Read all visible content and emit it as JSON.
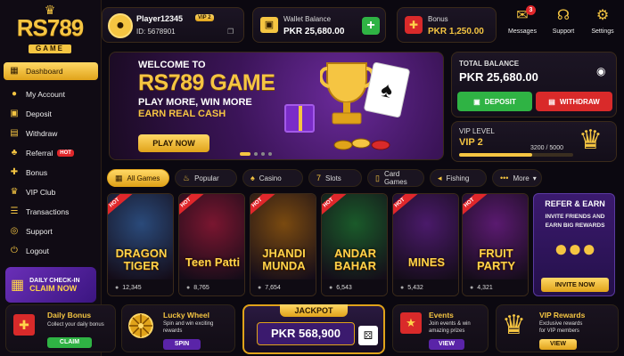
{
  "brand": {
    "name": "RS789",
    "sub": "GAME"
  },
  "sidebar": {
    "items": [
      {
        "label": "Dashboard",
        "icon": "dashboard-icon",
        "glyph": "▦"
      },
      {
        "label": "My Account",
        "icon": "user-icon",
        "glyph": "●"
      },
      {
        "label": "Deposit",
        "icon": "deposit-icon",
        "glyph": "▣"
      },
      {
        "label": "Withdraw",
        "icon": "withdraw-icon",
        "glyph": "▤"
      },
      {
        "label": "Referral",
        "icon": "referral-icon",
        "glyph": "♣"
      },
      {
        "label": "Bonus",
        "icon": "gift-icon",
        "glyph": "✚"
      },
      {
        "label": "VIP Club",
        "icon": "crown-icon",
        "glyph": "♛"
      },
      {
        "label": "Transactions",
        "icon": "list-icon",
        "glyph": "☰"
      },
      {
        "label": "Support",
        "icon": "headset-icon",
        "glyph": "◎"
      },
      {
        "label": "Logout",
        "icon": "logout-icon",
        "glyph": "⏻"
      }
    ],
    "hot_badge": "HOT",
    "checkin": {
      "line1": "DAILY CHECK-IN",
      "line2": "CLAIM NOW"
    }
  },
  "user": {
    "name": "Player12345",
    "vip_badge": "VIP 2",
    "id_label": "ID: 5678901"
  },
  "wallet": {
    "label": "Wallet Balance",
    "value": "PKR 25,680.00",
    "add": "+"
  },
  "bonus": {
    "label": "Bonus",
    "value": "PKR 1,250.00"
  },
  "header_actions": [
    {
      "label": "Messages",
      "icon": "mail-icon",
      "glyph": "✉",
      "badge": "3"
    },
    {
      "label": "Support",
      "icon": "headset-icon",
      "glyph": "☊",
      "badge": ""
    },
    {
      "label": "Settings",
      "icon": "gear-icon",
      "glyph": "⚙",
      "badge": ""
    }
  ],
  "banner": {
    "line1": "WELCOME TO",
    "line2": "RS789 GAME",
    "line3": "PLAY MORE, WIN MORE",
    "line4": "EARN REAL CASH",
    "cta": "PLAY NOW"
  },
  "balance": {
    "label": "TOTAL BALANCE",
    "value": "PKR 25,680.00",
    "deposit": "DEPOSIT",
    "withdraw": "WITHDRAW"
  },
  "vip": {
    "label": "VIP LEVEL",
    "level": "VIP 2",
    "progress_text": "3200 / 5000",
    "progress": 0.64
  },
  "tabs": [
    {
      "label": "All Games",
      "icon": "grid-icon",
      "glyph": "▦"
    },
    {
      "label": "Popular",
      "icon": "fire-icon",
      "glyph": "♨"
    },
    {
      "label": "Casino",
      "icon": "spade-icon",
      "glyph": "♠"
    },
    {
      "label": "Slots",
      "icon": "slots-icon",
      "glyph": "7"
    },
    {
      "label": "Card Games",
      "icon": "cards-icon",
      "glyph": "▯"
    },
    {
      "label": "Fishing",
      "icon": "fish-icon",
      "glyph": "◂"
    },
    {
      "label": "More",
      "icon": "more-icon",
      "glyph": "•••"
    }
  ],
  "games": [
    {
      "name": "DRAGON\nTIGER",
      "l1": "DRAGON",
      "l2": "TIGER",
      "players": "12,345",
      "bg": "#2a4a7a",
      "hot": true
    },
    {
      "name": "Teen Patti",
      "l1": "Teen Patti",
      "l2": "",
      "players": "8,765",
      "bg": "#7a1630",
      "hot": true
    },
    {
      "name": "JHANDI MUNDA",
      "l1": "JHANDI",
      "l2": "MUNDA",
      "players": "7,654",
      "bg": "#7a4a10",
      "hot": true
    },
    {
      "name": "ANDAR BAHAR",
      "l1": "ANDAR",
      "l2": "BAHAR",
      "players": "6,543",
      "bg": "#1a5a2a",
      "hot": true
    },
    {
      "name": "MINES",
      "l1": "MINES",
      "l2": "",
      "players": "5,432",
      "bg": "#4a1a6a",
      "hot": true
    },
    {
      "name": "FRUIT PARTY",
      "l1": "FRUIT",
      "l2": "PARTY",
      "players": "4,321",
      "bg": "#5a1a70",
      "hot": true
    }
  ],
  "refer": {
    "title": "REFER & EARN",
    "l1": "INVITE FRIENDS AND",
    "l2": "EARN BIG REWARDS",
    "cta": "INVITE NOW"
  },
  "bottom": {
    "daily": {
      "title": "Daily Bonus",
      "desc": "Collect your daily bonus",
      "cta": "CLAIM"
    },
    "wheel": {
      "title": "Lucky Wheel",
      "desc1": "Spin and win exciting",
      "desc2": "rewards",
      "cta": "SPIN"
    },
    "jackpot": {
      "label": "JACKPOT",
      "value": "PKR 568,900"
    },
    "events": {
      "title": "Events",
      "desc1": "Join events & win",
      "desc2": "amazing prizes",
      "cta": "VIEW"
    },
    "vip": {
      "title": "VIP Rewards",
      "desc1": "Exclusive rewards",
      "desc2": "for VIP members",
      "cta": "VIEW"
    }
  },
  "colors": {
    "accent": "#f5c542",
    "green": "#2fb344",
    "red": "#d92a2a",
    "purple": "#5a24a8"
  }
}
